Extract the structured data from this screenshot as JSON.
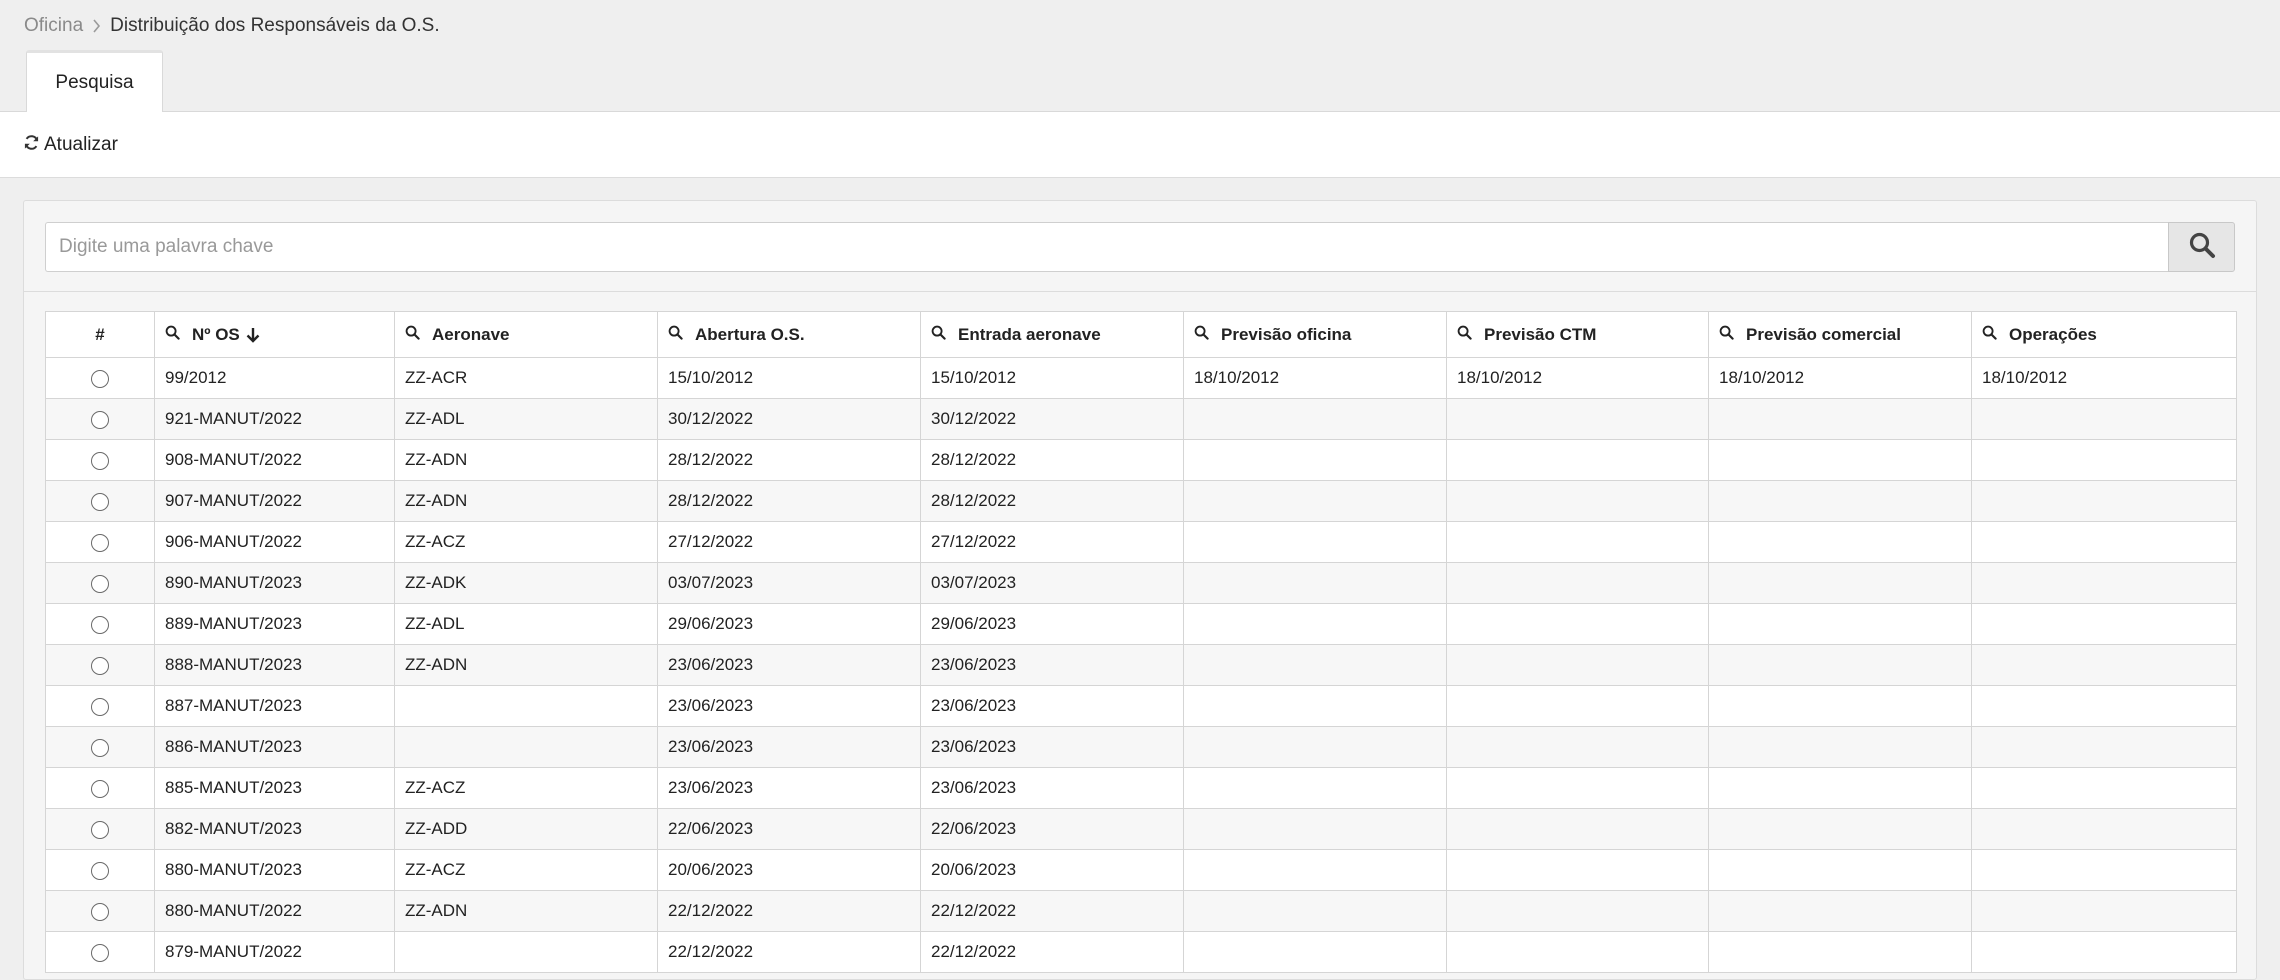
{
  "breadcrumb": {
    "parent": "Oficina",
    "current": "Distribuição dos Responsáveis da O.S."
  },
  "tabs": [
    {
      "label": "Pesquisa",
      "active": true
    }
  ],
  "toolbar": {
    "refresh_label": "Atualizar",
    "refresh_icon": "refresh-icon"
  },
  "search": {
    "placeholder": "Digite uma palavra chave",
    "value": "",
    "button_icon": "search-icon"
  },
  "table": {
    "columns": [
      {
        "key": "select",
        "label": "#",
        "filter_icon": false,
        "sorted": false
      },
      {
        "key": "os",
        "label": "Nº OS",
        "filter_icon": true,
        "sorted": "desc"
      },
      {
        "key": "aeronave",
        "label": "Aeronave",
        "filter_icon": true,
        "sorted": false
      },
      {
        "key": "abertura",
        "label": "Abertura O.S.",
        "filter_icon": true,
        "sorted": false
      },
      {
        "key": "entrada",
        "label": "Entrada aeronave",
        "filter_icon": true,
        "sorted": false
      },
      {
        "key": "prev_oficina",
        "label": "Previsão oficina",
        "filter_icon": true,
        "sorted": false
      },
      {
        "key": "prev_ctm",
        "label": "Previsão CTM",
        "filter_icon": true,
        "sorted": false
      },
      {
        "key": "prev_comercial",
        "label": "Previsão comercial",
        "filter_icon": true,
        "sorted": false
      },
      {
        "key": "operacoes",
        "label": "Operações",
        "filter_icon": true,
        "sorted": false
      }
    ],
    "rows": [
      [
        "99/2012",
        "ZZ-ACR",
        "15/10/2012",
        "15/10/2012",
        "18/10/2012",
        "18/10/2012",
        "18/10/2012",
        "18/10/2012"
      ],
      [
        "921-MANUT/2022",
        "ZZ-ADL",
        "30/12/2022",
        "30/12/2022",
        "",
        "",
        "",
        ""
      ],
      [
        "908-MANUT/2022",
        "ZZ-ADN",
        "28/12/2022",
        "28/12/2022",
        "",
        "",
        "",
        ""
      ],
      [
        "907-MANUT/2022",
        "ZZ-ADN",
        "28/12/2022",
        "28/12/2022",
        "",
        "",
        "",
        ""
      ],
      [
        "906-MANUT/2022",
        "ZZ-ACZ",
        "27/12/2022",
        "27/12/2022",
        "",
        "",
        "",
        ""
      ],
      [
        "890-MANUT/2023",
        "ZZ-ADK",
        "03/07/2023",
        "03/07/2023",
        "",
        "",
        "",
        ""
      ],
      [
        "889-MANUT/2023",
        "ZZ-ADL",
        "29/06/2023",
        "29/06/2023",
        "",
        "",
        "",
        ""
      ],
      [
        "888-MANUT/2023",
        "ZZ-ADN",
        "23/06/2023",
        "23/06/2023",
        "",
        "",
        "",
        ""
      ],
      [
        "887-MANUT/2023",
        "",
        "23/06/2023",
        "23/06/2023",
        "",
        "",
        "",
        ""
      ],
      [
        "886-MANUT/2023",
        "",
        "23/06/2023",
        "23/06/2023",
        "",
        "",
        "",
        ""
      ],
      [
        "885-MANUT/2023",
        "ZZ-ACZ",
        "23/06/2023",
        "23/06/2023",
        "",
        "",
        "",
        ""
      ],
      [
        "882-MANUT/2023",
        "ZZ-ADD",
        "22/06/2023",
        "22/06/2023",
        "",
        "",
        "",
        ""
      ],
      [
        "880-MANUT/2023",
        "ZZ-ACZ",
        "20/06/2023",
        "20/06/2023",
        "",
        "",
        "",
        ""
      ],
      [
        "880-MANUT/2022",
        "ZZ-ADN",
        "22/12/2022",
        "22/12/2022",
        "",
        "",
        "",
        ""
      ],
      [
        "879-MANUT/2022",
        "",
        "22/12/2022",
        "22/12/2022",
        "",
        "",
        "",
        ""
      ]
    ]
  }
}
